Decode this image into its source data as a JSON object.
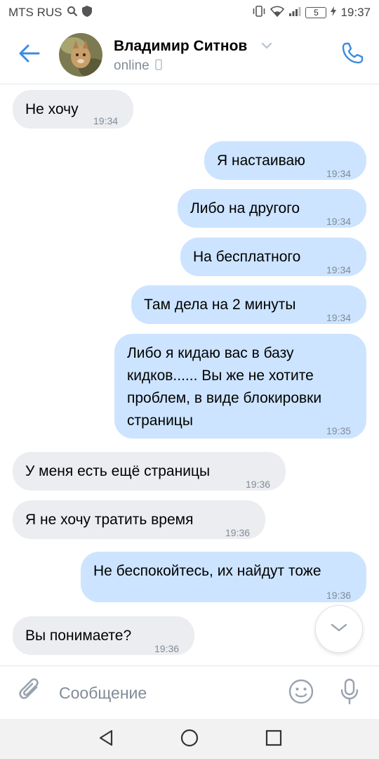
{
  "status_bar": {
    "carrier": "MTS RUS",
    "battery": "5",
    "time": "19:37"
  },
  "header": {
    "contact_name": "Владимир Ситнов",
    "status": "online"
  },
  "messages": [
    {
      "dir": "in",
      "text": "Не хочу",
      "time": "19:34"
    },
    {
      "dir": "out",
      "text": "Я настаиваю",
      "time": "19:34"
    },
    {
      "dir": "out",
      "text": "Либо на другого",
      "time": "19:34"
    },
    {
      "dir": "out",
      "text": "На бесплатного",
      "time": "19:34"
    },
    {
      "dir": "out",
      "text": "Там дела на 2 минуты",
      "time": "19:34"
    },
    {
      "dir": "out",
      "text": "Либо я кидаю вас в базу\nкидков...... Вы же не хотите\nпроблем, в виде блокировки\nстраницы",
      "time": "19:35"
    },
    {
      "dir": "in",
      "text": "У меня есть ещё страницы",
      "time": "19:36"
    },
    {
      "dir": "in",
      "text": "Я не хочу тратить время",
      "time": "19:36"
    },
    {
      "dir": "out",
      "text": "Не беспокойтесь, их найдут тоже",
      "time": "19:36"
    },
    {
      "dir": "in",
      "text": "Вы понимаете?",
      "time": "19:36"
    }
  ],
  "composer": {
    "placeholder": "Сообщение"
  },
  "icons": {
    "back": "arrow-left-icon",
    "call": "phone-icon",
    "attach": "paperclip-icon",
    "emoji": "smiley-icon",
    "mic": "microphone-icon",
    "scroll": "chevron-down-icon"
  },
  "colors": {
    "accent": "#3f8ae0",
    "incoming_bubble": "#ebedf0",
    "outgoing_bubble": "#cce4ff",
    "secondary_text": "#818c99"
  }
}
